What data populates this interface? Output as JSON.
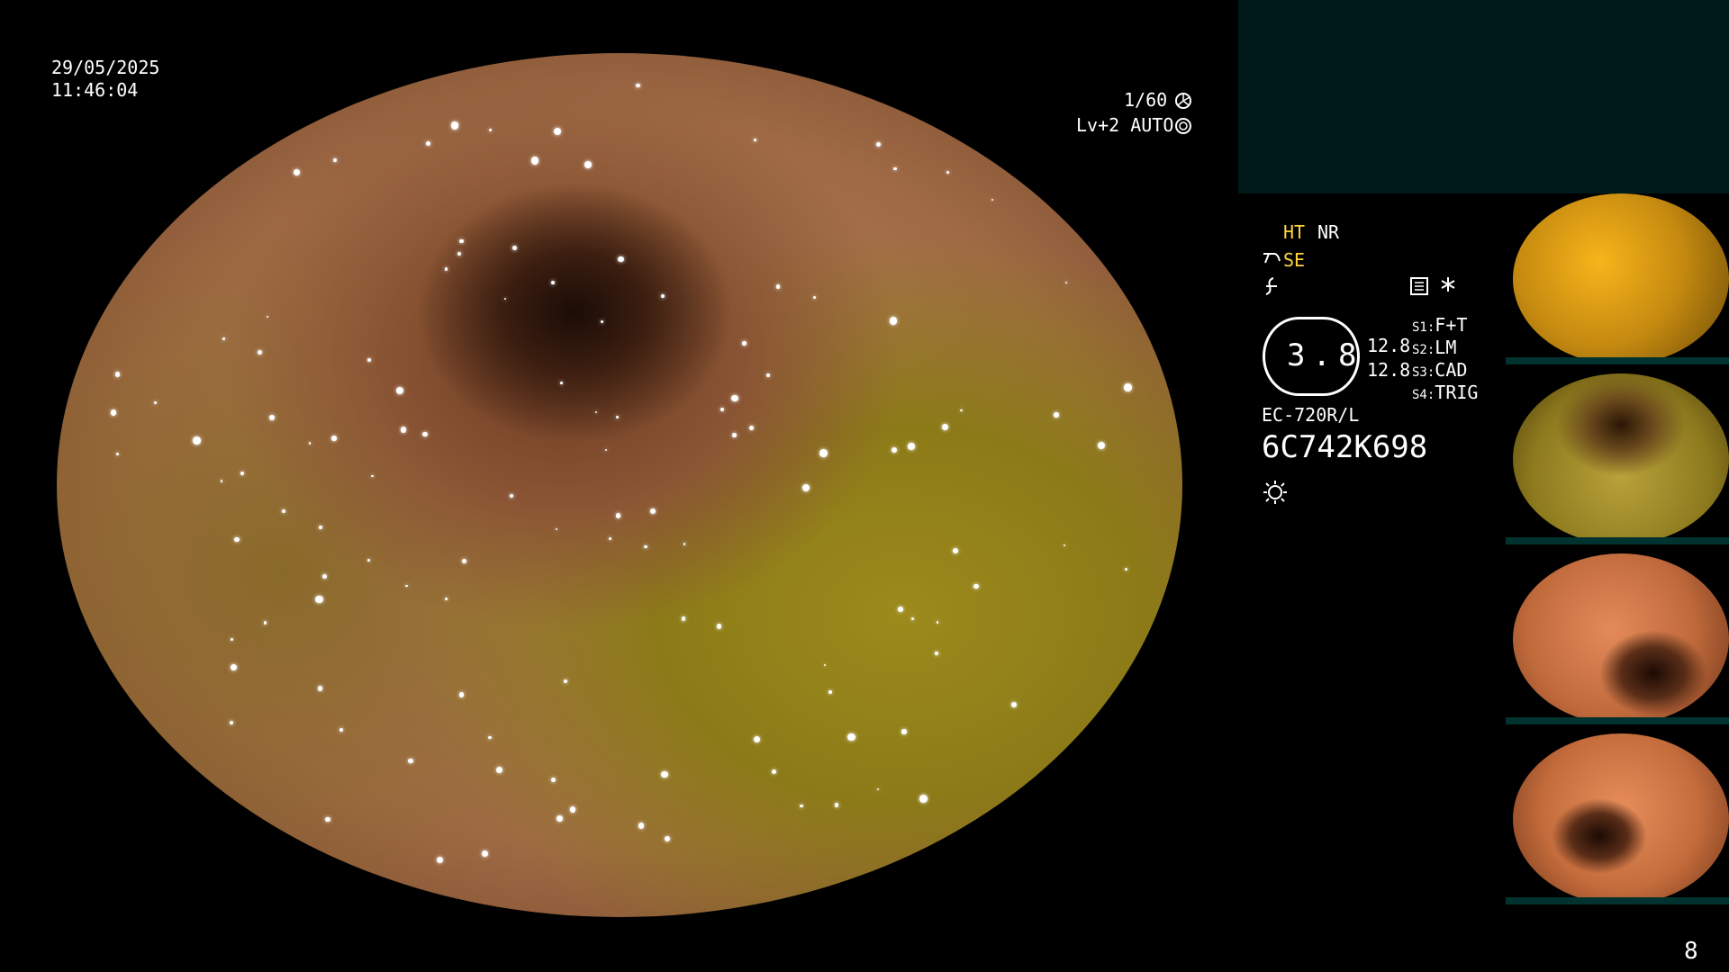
{
  "overlay": {
    "date": "29/05/2025",
    "time": "11:46:04",
    "shutter": "1/60",
    "level_mode": "Lv+2 AUTO",
    "ht": "HT",
    "nr": "NR",
    "se": "SE",
    "brightness": "3.8",
    "gain_top": "12.8",
    "gain_bottom": "12.8",
    "switches": [
      {
        "key": "S1:",
        "value": "F+T"
      },
      {
        "key": "S2:",
        "value": "LM"
      },
      {
        "key": "S3:",
        "value": "CAD"
      },
      {
        "key": "S4:",
        "value": "TRIG"
      }
    ],
    "scope_model": "EC-720R/L",
    "serial": "6C742K698",
    "page_number": "8",
    "colors": {
      "accent": "#ffd23a",
      "panel": "#00191a",
      "thumb_bar": "#00332f"
    }
  },
  "icons": {
    "shutter": "aperture-icon",
    "auto": "iris-icon",
    "structure": "structure-enhance-icon",
    "freeze": "freeze-icon",
    "memory": "memory-card-icon",
    "star": "asterisk-icon",
    "light": "light-icon"
  }
}
